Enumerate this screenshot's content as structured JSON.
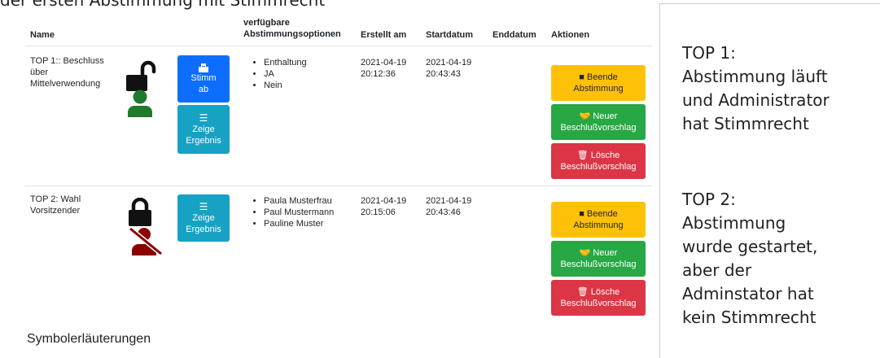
{
  "top_caption": "der ersten Abstimmung mit Stimmrecht",
  "table": {
    "headers": {
      "name": "Name",
      "options_line1": "verfügbare",
      "options_line2": "Abstimmungsoptionen",
      "created": "Erstellt am",
      "start": "Startdatum",
      "end": "Enddatum",
      "actions": "Aktionen"
    },
    "rows": [
      {
        "name": [
          "TOP 1:: Beschluss",
          "über",
          "Mittelverwendung"
        ],
        "vote_button": [
          "Stimm",
          "ab"
        ],
        "result_button": [
          "Zeige",
          "Ergebnis"
        ],
        "options": [
          "Enthaltung",
          "JA",
          "Nein"
        ],
        "created": [
          "2021-04-19",
          "20:12:36"
        ],
        "start": [
          "2021-04-19",
          "20:43:43"
        ],
        "end": "",
        "actions": {
          "stop": [
            "Beende",
            "Abstimmung"
          ],
          "new": [
            "Neuer",
            "Beschlußvorschlag"
          ],
          "delete": [
            "Lösche",
            "Beschlußvorschlag"
          ]
        }
      },
      {
        "name": [
          "TOP 2: Wahl",
          "Vorsitzender"
        ],
        "result_button": [
          "Zeige",
          "Ergebnis"
        ],
        "options": [
          "Paula Musterfrau",
          "Paul Mustermann",
          "Pauline Muster"
        ],
        "created": [
          "2021-04-19",
          "20:15:06"
        ],
        "start": [
          "2021-04-19",
          "20:43:46"
        ],
        "end": "",
        "actions": {
          "stop": [
            "Beende",
            "Abstimmung"
          ],
          "new": [
            "Neuer",
            "Beschlußvorschlag"
          ],
          "delete": [
            "Lösche",
            "Beschlußvorschlag"
          ]
        }
      }
    ]
  },
  "legend_heading": "Symbolerläuterungen",
  "notes": {
    "top1": [
      "TOP 1:",
      "Abstimmung läuft",
      "und Administrator",
      "hat Stimmrecht"
    ],
    "top2": [
      "TOP 2:",
      "Abstimmung",
      "wurde gestartet,",
      "aber der",
      "Adminstator hat",
      "kein Stimmrecht"
    ]
  },
  "icons": {
    "unlocked": "lock-open-icon",
    "locked": "lock-closed-icon",
    "user_voter": "user-icon",
    "user_no_vote": "user-slash-icon",
    "vote": "vote-box-icon",
    "list": "list-icon",
    "stop": "stop-square-icon",
    "handshake": "handshake-icon",
    "trash": "trash-icon"
  },
  "colors": {
    "blue": "#0d6efd",
    "cyan": "#17a2c3",
    "yellow": "#ffc107",
    "green": "#28a745",
    "red": "#dc3545",
    "user_green": "#1f7a2c",
    "user_red": "#8b0000"
  }
}
